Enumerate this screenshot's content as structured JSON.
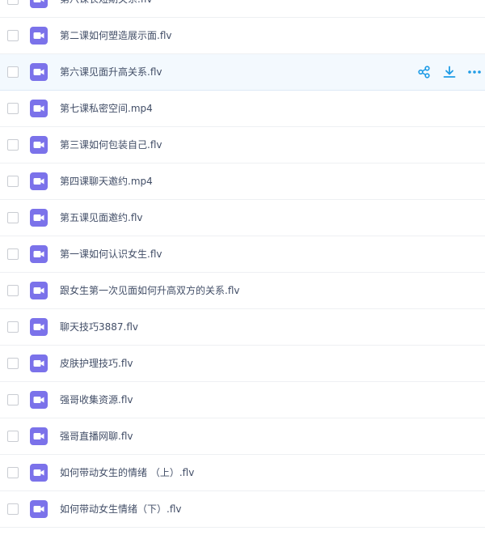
{
  "colors": {
    "accent": "#1f9ce6",
    "file_icon": "#7b72ea",
    "text": "#424e67",
    "hover_row": "#f3f9fe"
  },
  "icons": {
    "file": "video-file-icon",
    "share": "share-icon",
    "download": "download-icon",
    "more": "more-icon"
  },
  "hovered_index": 2,
  "files": [
    "第八课长短期关系.flv",
    "第二课如何塑造展示面.flv",
    "第六课见面升高关系.flv",
    "第七课私密空间.mp4",
    "第三课如何包装自己.flv",
    "第四课聊天邀约.mp4",
    "第五课见面邀约.flv",
    "第一课如何认识女生.flv",
    "跟女生第一次见面如何升高双方的关系.flv",
    "聊天技巧3887.flv",
    "皮肤护理技巧.flv",
    "强哥收集资源.flv",
    "强哥直播网聊.flv",
    "如何带动女生的情绪 （上）.flv",
    "如何带动女生情绪（下）.flv"
  ]
}
